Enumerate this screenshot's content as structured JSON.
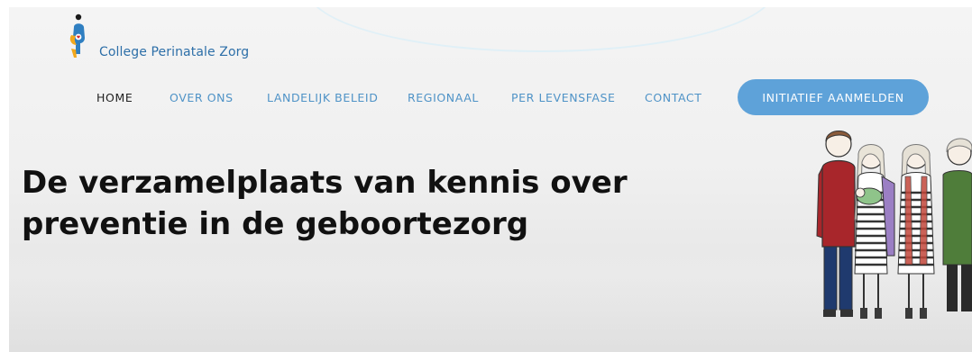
{
  "logo": {
    "text": "College Perinatale Zorg",
    "icon": "mother-and-child-icon"
  },
  "nav": {
    "items": [
      {
        "label": "HOME",
        "active": true
      },
      {
        "label": "OVER ONS",
        "active": false
      },
      {
        "label": "LANDELIJK BELEID",
        "active": false
      },
      {
        "label": "REGIONAAL",
        "active": false
      },
      {
        "label": "PER LEVENSFASE",
        "active": false
      },
      {
        "label": "CONTACT",
        "active": false
      }
    ],
    "cta_label": "INITIATIEF AANMELDEN"
  },
  "hero": {
    "headline_line1": "De verzamelplaats van kennis over",
    "headline_line2": "preventie in de geboortezorg",
    "illustration": "family-illustration"
  },
  "colors": {
    "brand_blue": "#2d6fa8",
    "nav_link": "#4f93c7",
    "cta_background": "#5ea2d9",
    "headline": "#111111"
  }
}
